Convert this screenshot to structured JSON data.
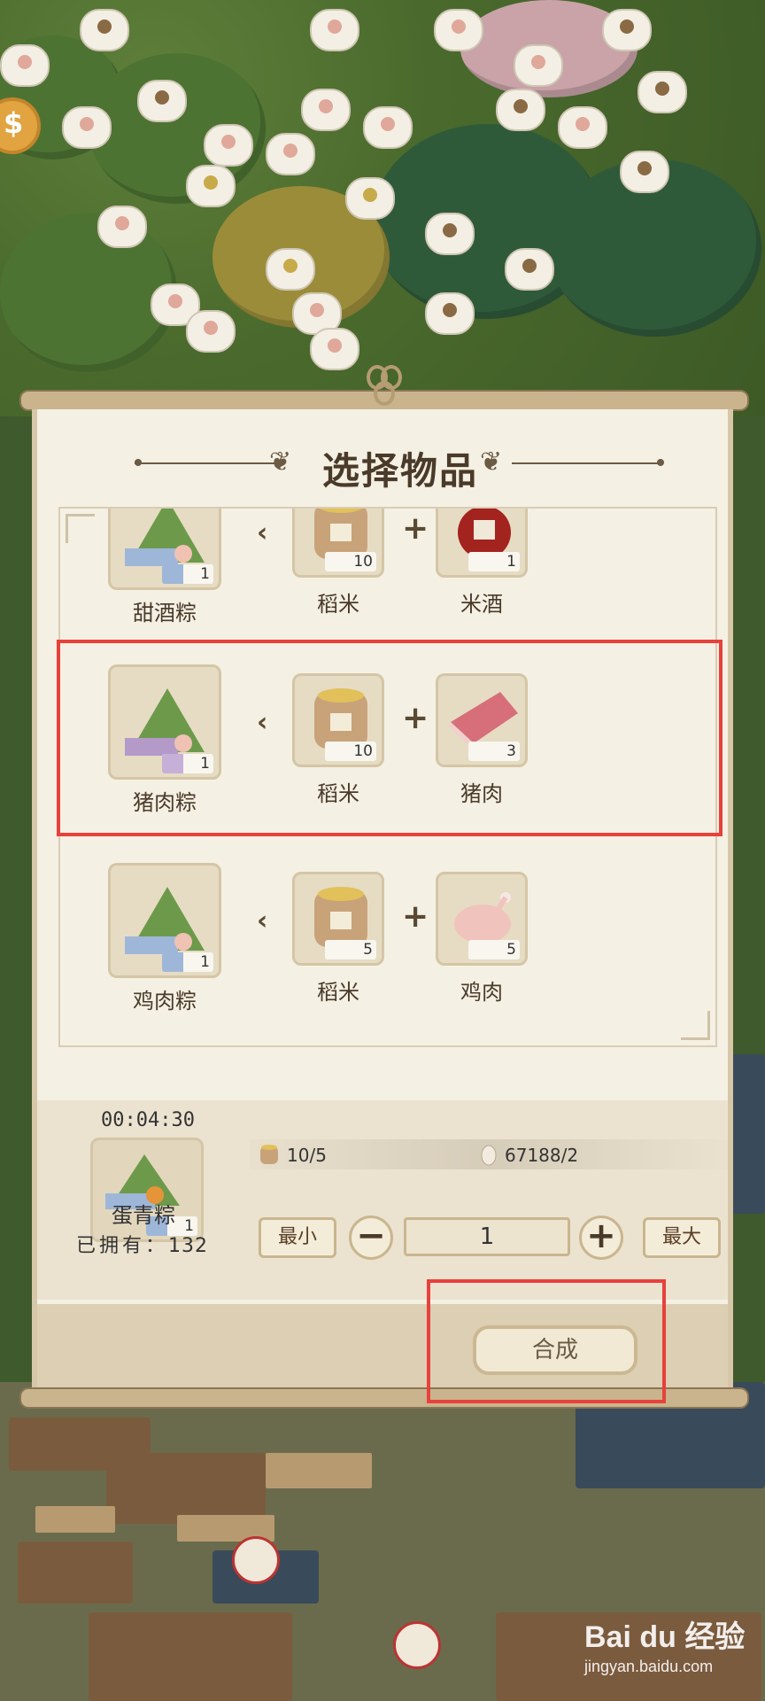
{
  "panel": {
    "title": "选择物品"
  },
  "recipes": [
    {
      "product": {
        "name": "甜酒粽",
        "count": "1"
      },
      "ingredients": [
        {
          "name": "稻米",
          "count": "10"
        },
        {
          "name": "米酒",
          "count": "1"
        }
      ]
    },
    {
      "product": {
        "name": "猪肉粽",
        "count": "1"
      },
      "ingredients": [
        {
          "name": "稻米",
          "count": "10"
        },
        {
          "name": "猪肉",
          "count": "3"
        }
      ]
    },
    {
      "product": {
        "name": "鸡肉粽",
        "count": "1"
      },
      "ingredients": [
        {
          "name": "稻米",
          "count": "5"
        },
        {
          "name": "鸡肉",
          "count": "5"
        }
      ]
    }
  ],
  "detail": {
    "timer": "00:04:30",
    "item_name": "蛋青粽",
    "item_count": "1",
    "owned_label": "已拥有：",
    "owned_count": "132",
    "requirements": [
      {
        "icon": "rice-sack-icon",
        "value": "10/5"
      },
      {
        "icon": "egg-icon",
        "value": "67188/2"
      }
    ],
    "min_label": "最小",
    "max_label": "最大",
    "minus_label": "−",
    "plus_label": "+",
    "quantity": "1"
  },
  "footer": {
    "synthesize_label": "合成"
  },
  "watermark": {
    "brand": "Bai du 经验",
    "url": "jingyan.baidu.com"
  },
  "colors": {
    "highlight": "#e8413c",
    "panel_bg": "#f4f0e3",
    "text_brown": "#4a3a2a"
  }
}
